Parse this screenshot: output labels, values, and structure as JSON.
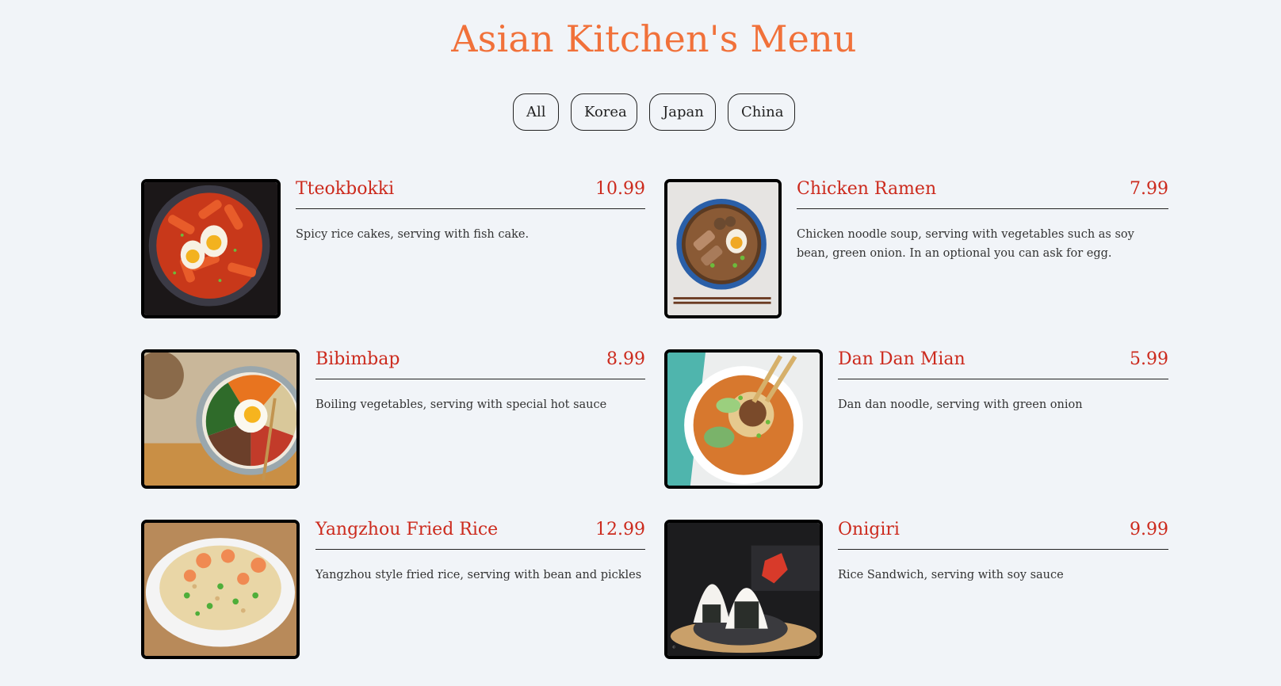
{
  "page": {
    "title": "Asian Kitchen's Menu"
  },
  "filters": [
    "All",
    "Korea",
    "Japan",
    "China"
  ],
  "colors": {
    "accent": "#f1713a",
    "item_text": "#cc2a1d",
    "background": "#f1f4f8"
  },
  "items": [
    {
      "name": "Tteokbokki",
      "price": "10.99",
      "description": "Spicy rice cakes, serving with fish cake.",
      "image": "tteokbokki-photo"
    },
    {
      "name": "Chicken Ramen",
      "price": "7.99",
      "description": "Chicken noodle soup, serving with vegetables such as soy bean, green onion. In an optional you can ask for egg.",
      "image": "chicken-ramen-photo"
    },
    {
      "name": "Bibimbap",
      "price": "8.99",
      "description": "Boiling vegetables, serving with special hot sauce",
      "image": "bibimbap-photo"
    },
    {
      "name": "Dan Dan Mian",
      "price": "5.99",
      "description": "Dan dan noodle, serving with green onion",
      "image": "dan-dan-mian-photo"
    },
    {
      "name": "Yangzhou Fried Rice",
      "price": "12.99",
      "description": "Yangzhou style fried rice, serving with bean and pickles",
      "image": "yangzhou-fried-rice-photo"
    },
    {
      "name": "Onigiri",
      "price": "9.99",
      "description": "Rice Sandwich, serving with soy sauce",
      "image": "onigiri-photo"
    }
  ]
}
